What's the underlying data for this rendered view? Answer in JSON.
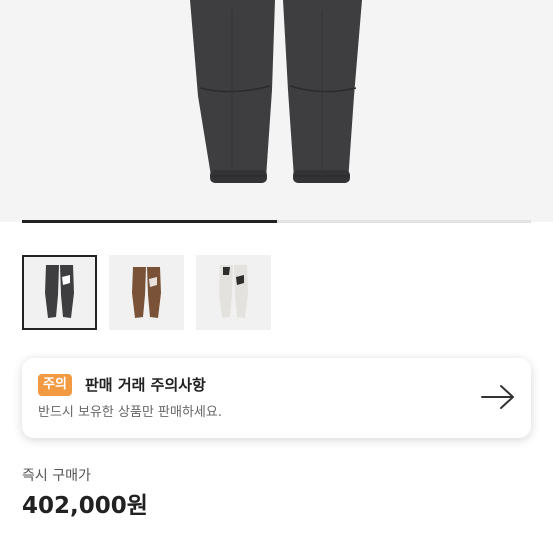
{
  "gallery": {
    "thumbnails": [
      {
        "color": "dark-gray",
        "selected": true
      },
      {
        "color": "brown",
        "selected": false
      },
      {
        "color": "white",
        "selected": false
      }
    ],
    "progress_fraction": 0.5
  },
  "notice": {
    "badge": "주의",
    "title": "판매 거래 주의사항",
    "description": "반드시 보유한 상품만 판매하세요.",
    "arrow_icon": "arrow-right-icon"
  },
  "price": {
    "label": "즉시 구매가",
    "value": "402,000원"
  },
  "colors": {
    "accent": "#f29a42",
    "text": "#222222",
    "background": "#f4f4f4"
  }
}
